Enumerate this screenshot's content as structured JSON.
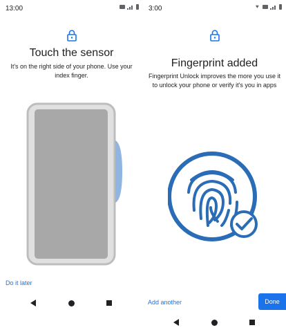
{
  "left": {
    "status": {
      "time": "13:00"
    },
    "title": "Touch the sensor",
    "description": "It's on the right side of your phone. Use your index finger.",
    "do_it_later": "Do it later"
  },
  "right": {
    "status": {
      "time": "3:00"
    },
    "title": "Fingerprint added",
    "description": "Fingerprint Unlock improves the more you use it to unlock your phone or verify it's you in apps",
    "add_another": "Add another",
    "done": "Done"
  },
  "icons": {
    "lock": "lock-icon",
    "back": "back-icon",
    "home": "home-icon",
    "recent": "recent-apps-icon",
    "check": "check-icon",
    "fingerprint": "fingerprint-icon"
  },
  "colors": {
    "accent": "#1a73e8",
    "circle_blue": "#2a6db6",
    "phone_body": "#bdbdbd",
    "phone_screen": "#a6a6a6",
    "sensor": "#8fb5e0"
  }
}
